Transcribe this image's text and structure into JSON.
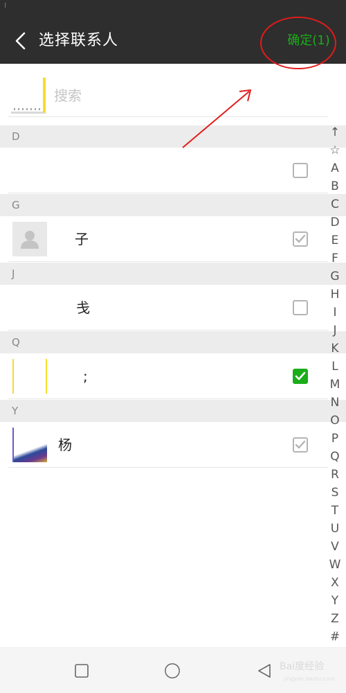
{
  "status_bar": {
    "indicator": "⁝"
  },
  "header": {
    "title": "选择联系人",
    "confirm_label": "确定(1)",
    "accent_color": "#1aad19"
  },
  "search": {
    "placeholder": "搜索",
    "value": ""
  },
  "sections": [
    {
      "letter": "D",
      "contacts": [
        {
          "name": "",
          "avatar": "none",
          "checkbox": "unchecked"
        }
      ]
    },
    {
      "letter": "G",
      "contacts": [
        {
          "name": "子",
          "avatar": "default-person-icon",
          "checkbox": "checked-disabled"
        }
      ]
    },
    {
      "letter": "J",
      "contacts": [
        {
          "name": "戋",
          "avatar": "none",
          "checkbox": "unchecked"
        }
      ]
    },
    {
      "letter": "Q",
      "contacts": [
        {
          "name": ";",
          "avatar": "yellow-thumbnail",
          "checkbox": "checked"
        }
      ]
    },
    {
      "letter": "Y",
      "contacts": [
        {
          "name": "杨",
          "avatar": "photo-thumbnail",
          "checkbox": "checked-disabled"
        }
      ]
    }
  ],
  "index_bar": [
    "↑",
    "☆",
    "A",
    "B",
    "C",
    "D",
    "E",
    "F",
    "G",
    "H",
    "I",
    "J",
    "K",
    "L",
    "M",
    "N",
    "O",
    "P",
    "Q",
    "R",
    "S",
    "T",
    "U",
    "V",
    "W",
    "X",
    "Y",
    "Z",
    "#"
  ],
  "nav_bar": {
    "buttons": [
      "recent-apps-icon",
      "home-icon",
      "back-icon"
    ]
  },
  "watermark": {
    "text": "Bai度经验",
    "sub": "jingyan.baidu.com"
  },
  "annotation": {
    "color": "#e31b1b"
  }
}
